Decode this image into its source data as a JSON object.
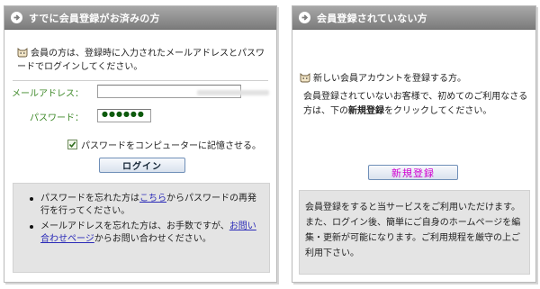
{
  "left_panel": {
    "title": "すでに会員登録がお済みの方",
    "intro_bold": "会員の方",
    "intro_rest": "は、登録時に入力されたメールアドレスとパスワードでログインしてください。",
    "email_label": "メールアドレス：",
    "email_value": "",
    "password_label": "パスワード：",
    "password_value": "●●●●●●",
    "remember_label": "パスワードをコンピューターに記憶させる。",
    "remember_checked": true,
    "login_button": "ログイン",
    "help": {
      "item1_before": "パスワードを忘れた方は",
      "item1_link": "こちら",
      "item1_after": "からパスワードの再発行を行ってください。",
      "item2_before": "メールアドレスを忘れた方は、お手数ですが、",
      "item2_link": "お問い合わせページ",
      "item2_after": "からお問い合わせください。"
    }
  },
  "right_panel": {
    "title": "会員登録されていない方",
    "intro": "新しい会員アカウントを登録する方。",
    "body_before": "会員登録されていないお客様で、初めてのご利用なさる方は、下の",
    "body_bold": "新規登録",
    "body_after": "をクリックしてください。",
    "register_button": "新規登録",
    "info_line1": "会員登録をすると当サービスをご利用いただけます。",
    "info_line2": "また、ログイン後、簡単にご自身のホームページを編集・更新が可能になります。ご利用規程を厳守の上ご利用下さい。"
  },
  "icons": {
    "header_arrow": "arrow-circle-icon",
    "member_icon": "cat-face-icon",
    "checkbox": "checkmark-icon"
  },
  "colors": {
    "header_bg": "#8f8f8f",
    "label_green": "#3f8a2a",
    "link_blue": "#2b2bb8",
    "register_magenta": "#d000d0",
    "info_bg": "#e4e4e4"
  }
}
